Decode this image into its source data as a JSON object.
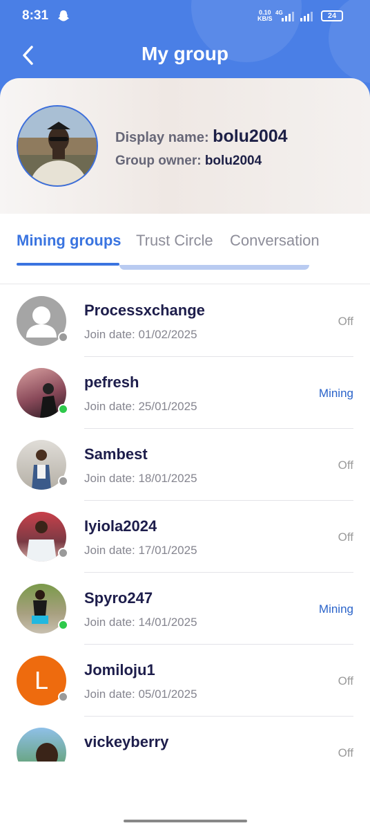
{
  "status_bar": {
    "time": "8:31",
    "net_speed": "0.10",
    "net_unit": "KB/S",
    "network": "4G",
    "battery": "24"
  },
  "header": {
    "title": "My group"
  },
  "profile": {
    "display_label": "Display name: ",
    "display_name": "bolu2004",
    "owner_label": "Group owner: ",
    "owner_name": "bolu2004"
  },
  "tabs": [
    {
      "label": "Mining groups",
      "active": true
    },
    {
      "label": "Trust Circle",
      "active": false
    },
    {
      "label": "Conversation",
      "active": false
    }
  ],
  "colors": {
    "accent": "#3a74e0",
    "header": "#4a7fe6",
    "online": "#2ec94b",
    "offline": "#9a9a9a",
    "mining": "#2a63c9",
    "off": "#9a9a9a"
  },
  "members": [
    {
      "name": "Processxchange",
      "join": "Join date: 01/02/2025",
      "status": "Off",
      "online": false,
      "avatar": "default-user-icon"
    },
    {
      "name": "pefresh",
      "join": "Join date: 25/01/2025",
      "status": "Mining",
      "online": true,
      "avatar": "photo"
    },
    {
      "name": "Sambest",
      "join": "Join date: 18/01/2025",
      "status": "Off",
      "online": false,
      "avatar": "photo"
    },
    {
      "name": "Iyiola2024",
      "join": "Join date: 17/01/2025",
      "status": "Off",
      "online": false,
      "avatar": "photo"
    },
    {
      "name": "Spyro247",
      "join": "Join date: 14/01/2025",
      "status": "Mining",
      "online": true,
      "avatar": "photo"
    },
    {
      "name": "Jomiloju1",
      "join": "Join date: 05/01/2025",
      "status": "Off",
      "online": false,
      "avatar": "L"
    },
    {
      "name": "vickeyberry",
      "join": "",
      "status": "Off",
      "online": false,
      "avatar": "photo"
    }
  ]
}
